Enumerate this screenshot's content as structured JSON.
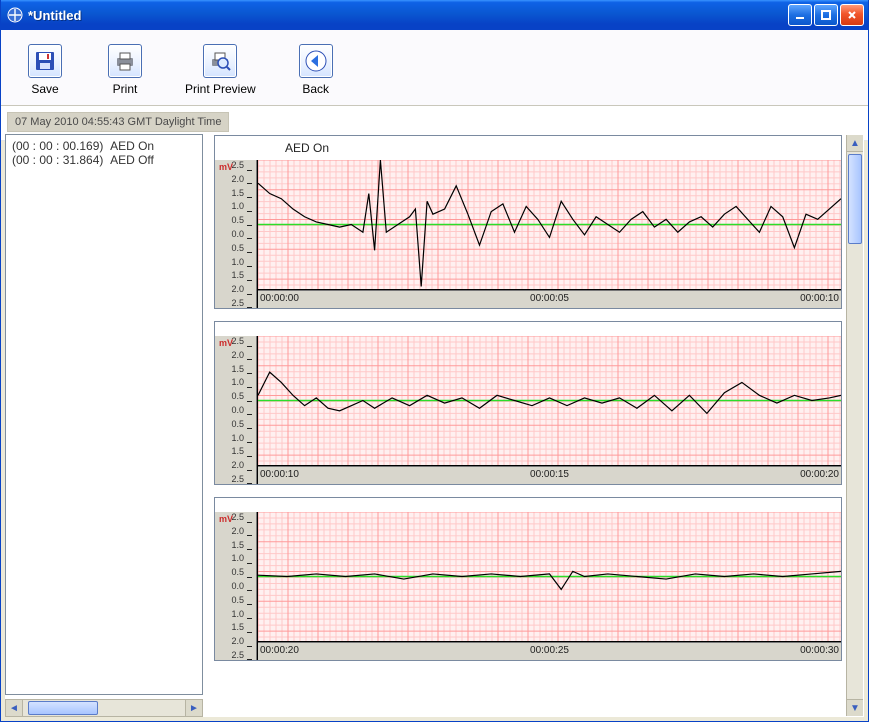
{
  "window": {
    "title": "*Untitled"
  },
  "toolbar": {
    "save": {
      "label": "Save"
    },
    "print": {
      "label": "Print"
    },
    "preview": {
      "label": "Print Preview"
    },
    "back": {
      "label": "Back"
    }
  },
  "timestamp": "07 May 2010 04:55:43 GMT Daylight Time",
  "events": [
    {
      "time": "(00 : 00 : 00.169)",
      "label": "AED On"
    },
    {
      "time": "(00 : 00 : 31.864)",
      "label": "AED Off"
    }
  ],
  "axis": {
    "y_unit": "mV",
    "y_ticks": [
      "2.5",
      "2.0",
      "1.5",
      "1.0",
      "0.5",
      "0.0",
      "0.5",
      "1.0",
      "1.5",
      "2.0",
      "2.5"
    ],
    "y_min": -2.5,
    "y_max": 2.5
  },
  "chart_data": [
    {
      "type": "line",
      "title": "AED On",
      "ylabel": "mV",
      "ylim": [
        -2.5,
        2.5
      ],
      "xlabel": "",
      "x_ticks": [
        "00:00:00",
        "00:00:05",
        "00:00:10"
      ],
      "x": [
        0.0,
        0.2,
        0.4,
        0.6,
        0.8,
        1.0,
        1.2,
        1.4,
        1.6,
        1.8,
        1.9,
        2.0,
        2.1,
        2.2,
        2.4,
        2.6,
        2.7,
        2.8,
        2.9,
        3.0,
        3.2,
        3.4,
        3.6,
        3.8,
        4.0,
        4.2,
        4.4,
        4.6,
        4.8,
        5.0,
        5.2,
        5.4,
        5.6,
        5.8,
        6.0,
        6.2,
        6.4,
        6.6,
        6.8,
        7.0,
        7.2,
        7.4,
        7.6,
        7.8,
        8.0,
        8.2,
        8.4,
        8.6,
        8.8,
        9.0,
        9.2,
        9.4,
        9.6,
        9.8,
        10.0
      ],
      "y": [
        1.6,
        1.2,
        1.0,
        0.6,
        0.3,
        0.1,
        0.0,
        -0.1,
        0.0,
        -0.3,
        1.2,
        -1.0,
        2.5,
        -0.3,
        0.0,
        0.3,
        0.6,
        -2.4,
        0.9,
        0.4,
        0.6,
        1.5,
        0.4,
        -0.8,
        0.5,
        0.8,
        -0.3,
        0.7,
        0.2,
        -0.5,
        0.9,
        0.2,
        -0.4,
        0.3,
        0.0,
        -0.3,
        0.2,
        0.5,
        -0.1,
        0.2,
        -0.3,
        0.1,
        0.3,
        -0.1,
        0.4,
        0.7,
        0.2,
        -0.3,
        0.7,
        0.3,
        -0.9,
        0.4,
        0.2,
        0.6,
        1.0
      ]
    },
    {
      "type": "line",
      "title": "",
      "ylabel": "mV",
      "ylim": [
        -2.5,
        2.5
      ],
      "xlabel": "",
      "x_ticks": [
        "00:00:10",
        "00:00:15",
        "00:00:20"
      ],
      "x": [
        10.0,
        10.2,
        10.4,
        10.6,
        10.8,
        11.0,
        11.2,
        11.4,
        11.6,
        11.8,
        12.0,
        12.3,
        12.6,
        12.9,
        13.2,
        13.5,
        13.8,
        14.1,
        14.4,
        14.7,
        15.0,
        15.3,
        15.6,
        15.9,
        16.2,
        16.5,
        16.8,
        17.1,
        17.4,
        17.7,
        18.0,
        18.3,
        18.6,
        18.9,
        19.2,
        19.5,
        19.8,
        20.0
      ],
      "y": [
        0.2,
        1.1,
        0.7,
        0.2,
        -0.2,
        0.1,
        -0.3,
        -0.4,
        -0.2,
        0.0,
        -0.3,
        0.1,
        -0.2,
        0.2,
        -0.1,
        0.1,
        -0.3,
        0.2,
        0.0,
        -0.2,
        0.1,
        -0.2,
        0.1,
        -0.1,
        0.1,
        -0.3,
        0.2,
        -0.4,
        0.2,
        -0.5,
        0.3,
        0.7,
        0.2,
        -0.1,
        0.2,
        0.0,
        0.1,
        0.2
      ]
    },
    {
      "type": "line",
      "title": "",
      "ylabel": "mV",
      "ylim": [
        -2.5,
        2.5
      ],
      "xlabel": "",
      "x_ticks": [
        "00:00:20",
        "00:00:25",
        "00:00:30"
      ],
      "x": [
        20.0,
        20.5,
        21.0,
        21.5,
        22.0,
        22.5,
        23.0,
        23.5,
        24.0,
        24.5,
        25.0,
        25.2,
        25.4,
        25.6,
        26.0,
        26.5,
        27.0,
        27.5,
        28.0,
        28.5,
        29.0,
        29.5,
        30.0
      ],
      "y": [
        0.05,
        0.0,
        0.1,
        0.0,
        0.1,
        -0.1,
        0.1,
        0.0,
        0.1,
        0.0,
        0.1,
        -0.5,
        0.2,
        0.0,
        0.1,
        0.0,
        -0.1,
        0.1,
        0.0,
        0.1,
        0.0,
        0.1,
        0.2
      ]
    }
  ]
}
